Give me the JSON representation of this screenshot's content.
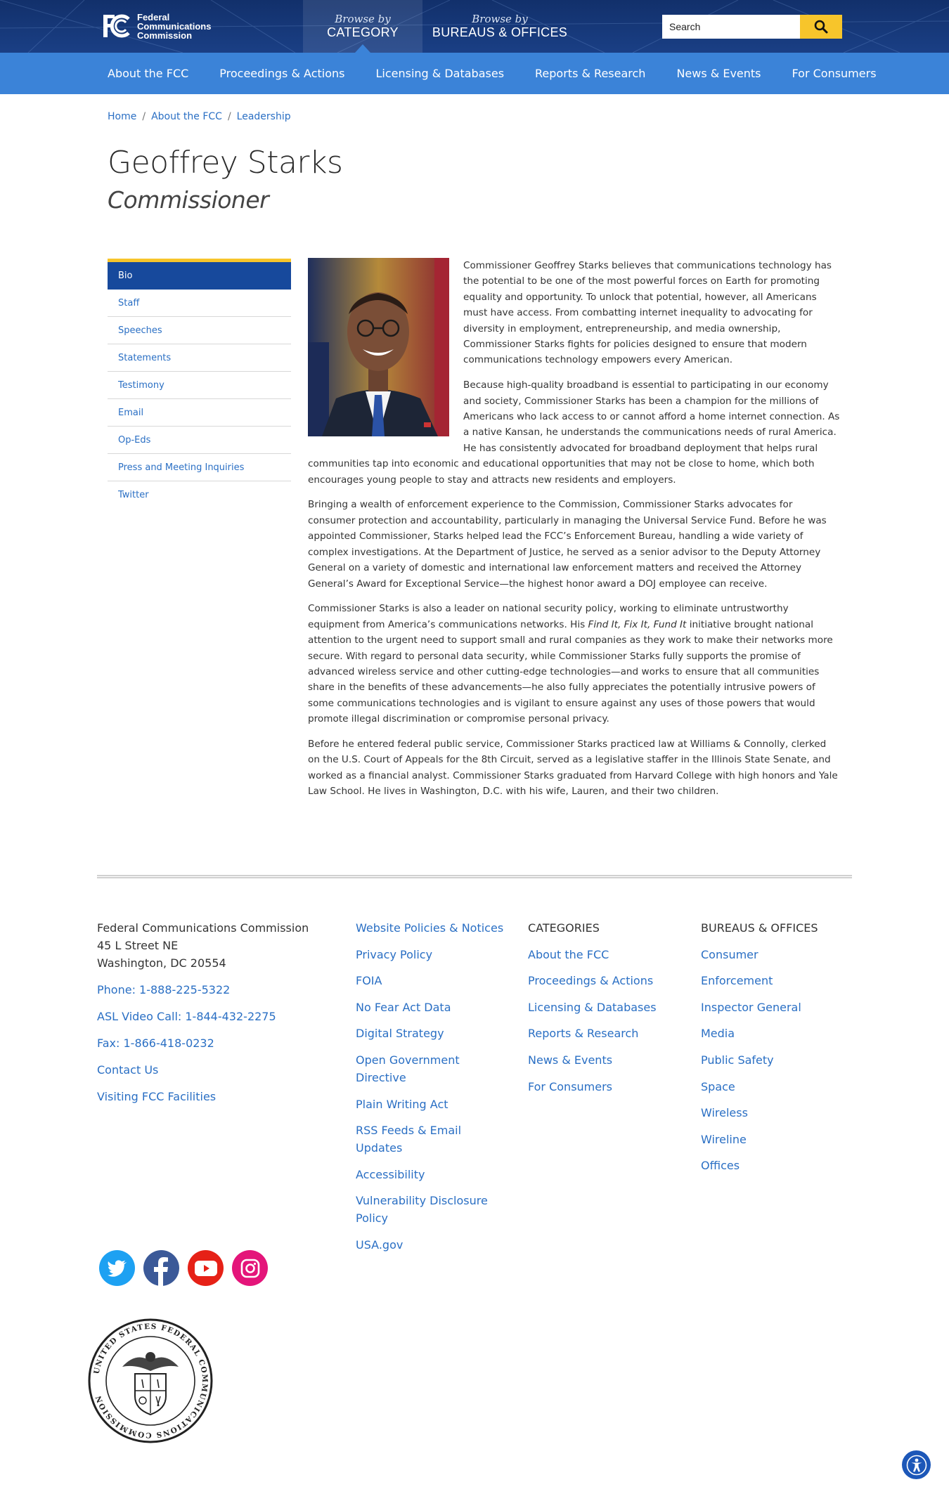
{
  "brand": {
    "logo_line1": "Federal",
    "logo_line2": "Communications",
    "logo_line3": "Commission",
    "colors": {
      "header": "#12306b",
      "nav": "#3b83d8",
      "accent": "#f7c52b",
      "link": "#2a6fc4",
      "active": "#17499c"
    }
  },
  "header": {
    "browse_category_small": "Browse by",
    "browse_category_big": "CATEGORY",
    "browse_bureaus_small": "Browse by",
    "browse_bureaus_big": "BUREAUS & OFFICES",
    "search_placeholder": "Search",
    "search_icon": "search-icon"
  },
  "nav": [
    "About the FCC",
    "Proceedings & Actions",
    "Licensing & Databases",
    "Reports & Research",
    "News & Events",
    "For Consumers"
  ],
  "breadcrumb": [
    "Home",
    "About the FCC",
    "Leadership"
  ],
  "page": {
    "title": "Geoffrey Starks",
    "subtitle": "Commissioner"
  },
  "sidenav": [
    "Bio",
    "Staff",
    "Speeches",
    "Statements",
    "Testimony",
    "Email",
    "Op-Eds",
    "Press and Meeting Inquiries",
    "Twitter"
  ],
  "bio": {
    "p1": "Commissioner Geoffrey Starks believes that communications technology has the potential to be one of the most powerful forces on Earth for promoting equality and opportunity. To unlock that potential, however, all Americans must have access. From combatting internet inequality to advocating for diversity in employment, entrepreneurship, and media ownership, Commissioner Starks fights for policies designed to ensure that modern communications technology empowers every American.",
    "p2": "Because high-quality broadband is essential to participating in our economy and society, Commissioner Starks has been a champion for the millions of Americans who lack access to or cannot afford a home internet connection. As a native Kansan, he understands the communications needs of rural America. He has consistently advocated for broadband deployment that helps rural communities tap into economic and educational opportunities that may not be close to home, which both encourages young people to stay and attracts new residents and employers.",
    "p3": "Bringing a wealth of enforcement experience to the Commission, Commissioner Starks advocates for consumer protection and accountability, particularly in managing the Universal Service Fund. Before he was appointed Commissioner, Starks helped lead the FCC’s Enforcement Bureau, handling a wide variety of complex investigations. At the Department of Justice, he served as a senior advisor to the Deputy Attorney General on a variety of domestic and international law enforcement matters and received the Attorney General’s Award for Exceptional Service—the highest honor award a DOJ employee can receive.",
    "p4_a": "Commissioner Starks is also a leader on national security policy, working to eliminate untrustworthy equipment from America’s communications networks. His ",
    "p4_em": "Find It, Fix It, Fund It",
    "p4_b": " initiative brought national attention to the urgent need to support small and rural companies as they work to make their networks more secure. With regard to personal data security, while Commissioner Starks fully supports the promise of advanced wireless service and other cutting-edge technologies—and works to ensure that all communities share in the benefits of these advancements—he also fully appreciates the potentially intrusive powers of some communications technologies and is vigilant to ensure against any uses of those powers that would promote illegal discrimination or compromise personal privacy.",
    "p5": "Before he entered federal public service, Commissioner Starks practiced law at Williams & Connolly, clerked on the U.S. Court of Appeals for the 8th Circuit, served as a legislative staffer in the Illinois State Senate, and worked as a financial analyst. Commissioner Starks graduated from Harvard College with high honors and Yale Law School. He lives in Washington, D.C. with his wife, Lauren, and their two children."
  },
  "footer": {
    "org": "Federal Communications Commission",
    "street": "45 L Street NE",
    "city": "Washington, DC 20554",
    "phone": "Phone: 1-888-225-5322",
    "asl": "ASL Video Call: 1-844-432-2275",
    "fax": "Fax: 1-866-418-0232",
    "contact": "Contact Us",
    "visiting": "Visiting FCC Facilities",
    "policies": [
      "Website Policies & Notices",
      "Privacy Policy",
      "FOIA",
      "No Fear Act Data",
      "Digital Strategy",
      "Open Government Directive",
      "Plain Writing Act",
      "RSS Feeds & Email Updates",
      "Accessibility",
      "Vulnerability Disclosure Policy",
      "USA.gov"
    ],
    "categories_heading": "CATEGORIES",
    "categories": [
      "About the FCC",
      "Proceedings & Actions",
      "Licensing & Databases",
      "Reports & Research",
      "News & Events",
      "For Consumers"
    ],
    "bureaus_heading": "BUREAUS & OFFICES",
    "bureaus": [
      "Consumer",
      "Enforcement",
      "Inspector General",
      "Media",
      "Public Safety",
      "Space",
      "Wireless",
      "Wireline",
      "Offices"
    ],
    "social": [
      {
        "name": "twitter-icon",
        "color": "#1da1f2"
      },
      {
        "name": "facebook-icon",
        "color": "#3b5998"
      },
      {
        "name": "youtube-icon",
        "color": "#e62117"
      },
      {
        "name": "instagram-icon",
        "color": "#e4157a"
      }
    ],
    "seal_text": "UNITED STATES FEDERAL COMMUNICATIONS COMMISSION"
  }
}
